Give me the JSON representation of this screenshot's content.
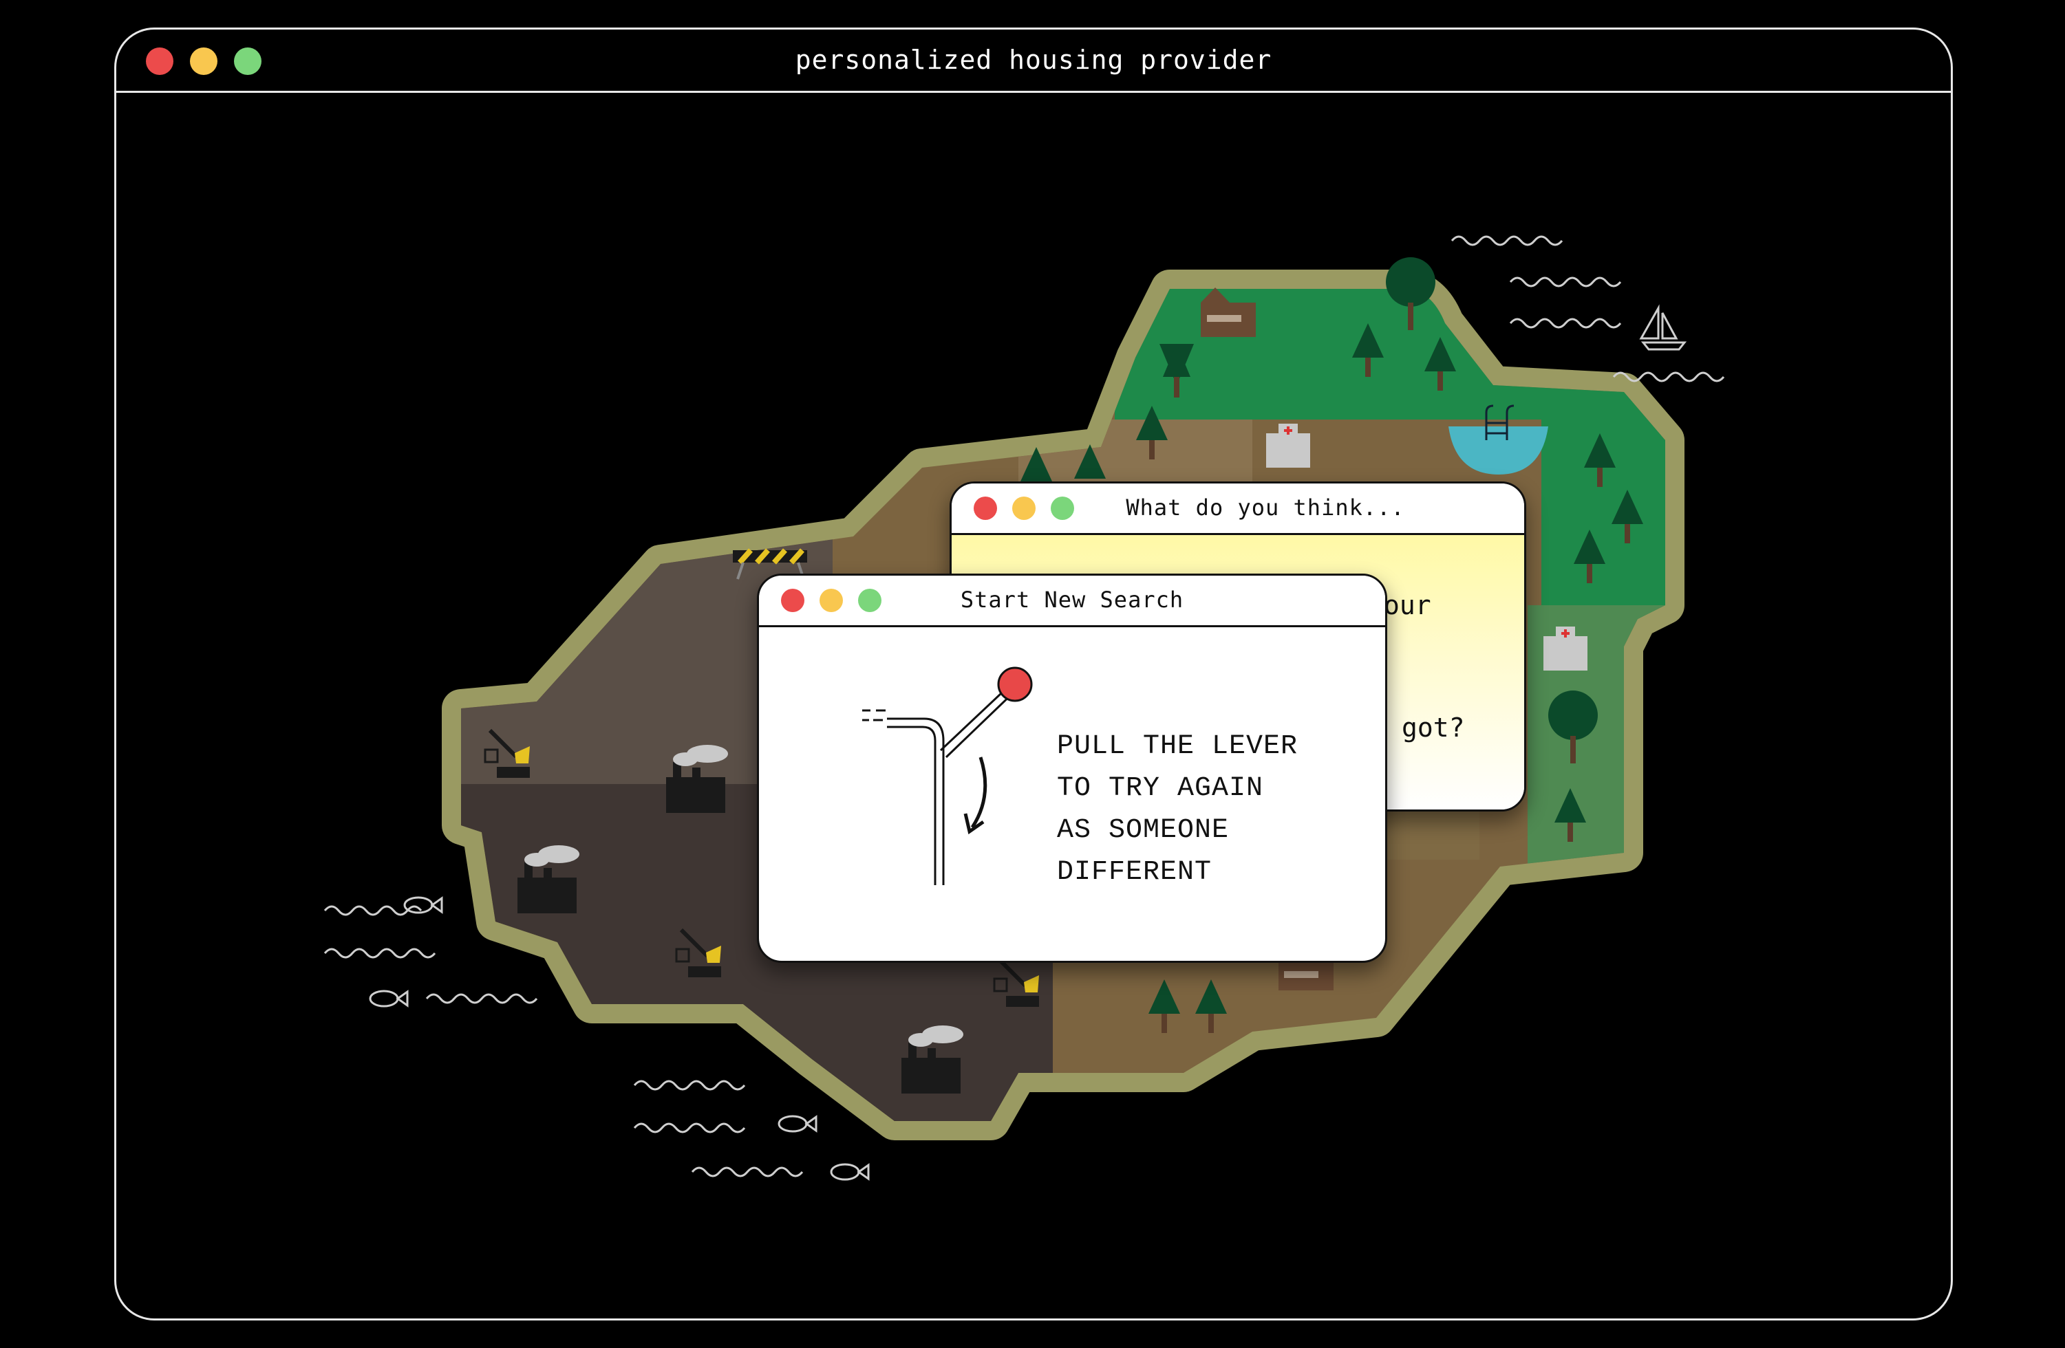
{
  "window": {
    "title": "personalized housing provider",
    "controls": {
      "close_color": "#ec4b4b",
      "minimize_color": "#f9c74f",
      "maximize_color": "#7bd67b"
    }
  },
  "colors": {
    "background": "#000000",
    "island_border": "#9a9a62",
    "industrial_dark": "#3f3633",
    "industrial_light": "#5a4f47",
    "dirt": "#7c6440",
    "forest": "#1e8a4a",
    "forest_light": "#4f8a52",
    "pool": "#4bb6c4"
  },
  "map": {
    "icons": [
      "crane-icon",
      "factory-icon",
      "construction-barrier-icon",
      "house-icon",
      "hospital-icon",
      "swimming-pool-icon",
      "pine-tree-icon",
      "round-tree-icon",
      "sailboat-icon",
      "fish-icon",
      "wave-icon"
    ]
  },
  "dialogs": {
    "question": {
      "title": "What do you think...",
      "visible_line_1": "our",
      "visible_line_2": "got?"
    },
    "search": {
      "title": "Start New Search",
      "lines": [
        "PULL THE LEVER",
        "TO TRY AGAIN",
        "AS SOMEONE",
        "DIFFERENT"
      ],
      "lever_knob_color": "#e84848"
    }
  }
}
